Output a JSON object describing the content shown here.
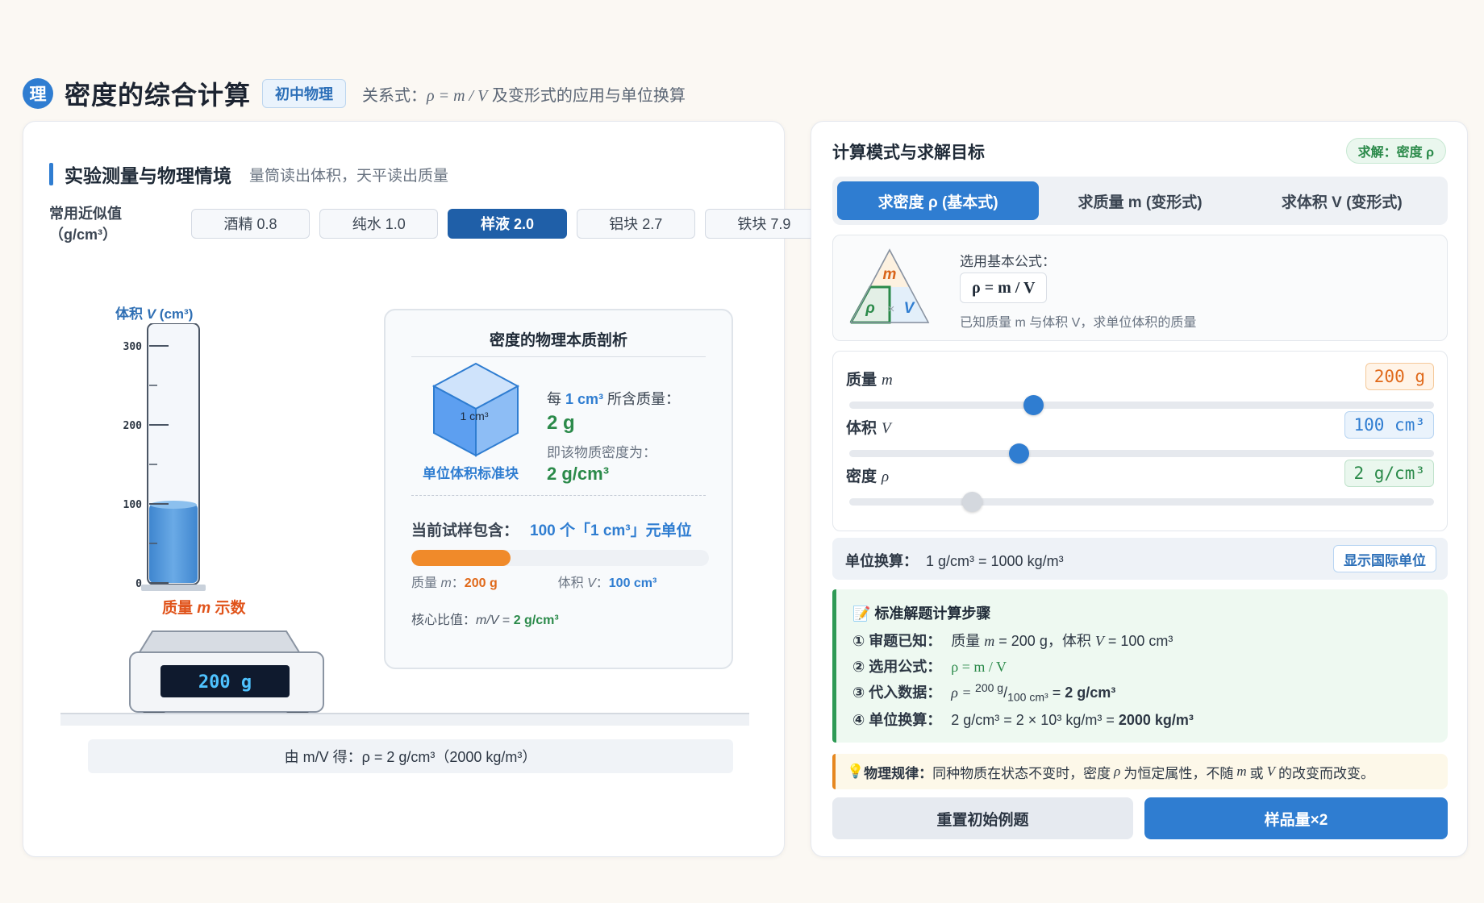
{
  "header": {
    "logo": "理",
    "title": "密度的综合计算",
    "tag": "初中物理",
    "subtitle_prefix": "关系式：",
    "subtitle_formula": "ρ = m / V",
    "subtitle_suffix": " 及变形式的应用与单位换算"
  },
  "left": {
    "section_title": "实验测量与物理情境",
    "section_subtitle": "量筒读出体积，天平读出质量",
    "approx_label": "常用近似值（g/cm³）",
    "chips": [
      "酒精 0.8",
      "纯水 1.0",
      "样液 2.0",
      "铝块 2.7",
      "铁块 7.9"
    ],
    "active_chip_index": 2,
    "cylinder": {
      "axis_label_prefix": "体积 ",
      "axis_label_var": "V",
      "axis_label_unit": " (cm³)",
      "ticks": [
        "300",
        "200",
        "100",
        "0"
      ],
      "tick_values": [
        300,
        200,
        100,
        0
      ],
      "max": 300,
      "liquid_volume": 100
    },
    "scale": {
      "label_prefix": "质量 ",
      "label_var": "m",
      "label_suffix": " 示数",
      "display": "200 g"
    },
    "result_strip": "由 m/V 得：ρ = 2 g/cm³（2000 kg/m³）",
    "analysis": {
      "title": "密度的物理本质剖析",
      "cube_label": "1 cm³",
      "cube_caption": "单位体积标准块",
      "per_prefix": "每 ",
      "per_unit": "1 cm³",
      "per_suffix": " 所含质量：",
      "per_value": "2 g",
      "density_label": "即该物质密度为：",
      "density_value": "2 g/cm³",
      "contain_label": "当前试样包含：",
      "contain_value": "100 个「1 cm³」元单位",
      "progress_fraction": 0.333,
      "mass_label": "质量 ",
      "mass_var": "m",
      "mass_colon": "：",
      "mass_value": "200 g",
      "vol_label": "体积 ",
      "vol_var": "V",
      "vol_colon": "：",
      "vol_value": "100 cm³",
      "ratio_label": "核心比值：",
      "ratio_expr": "m/V",
      "ratio_eq": " = ",
      "ratio_value": "2 g/cm³"
    }
  },
  "right": {
    "title": "计算模式与求解目标",
    "solve_badge": "求解：密度 ρ",
    "modes": [
      "求密度 ρ (基本式)",
      "求质量 m (变形式)",
      "求体积 V (变形式)"
    ],
    "active_mode": 0,
    "formula_card": {
      "label": "选用基本公式：",
      "formula": "ρ = m / V",
      "desc": "已知质量 m 与体积 V，求单位体积的质量",
      "tri_top": "m",
      "tri_left": "ρ",
      "tri_mid": "×",
      "tri_right": "V"
    },
    "sliders": [
      {
        "label": "质量",
        "var": "m",
        "value": "200 g",
        "fraction": 0.315
      },
      {
        "label": "体积",
        "var": "V",
        "value": "100 cm³",
        "fraction": 0.29
      },
      {
        "label": "密度",
        "var": "ρ",
        "value": "2 g/cm³",
        "fraction": 0.21
      }
    ],
    "unit": {
      "label": "单位换算：",
      "text": "1 g/cm³ = 1000 kg/m³",
      "button": "显示国际单位"
    },
    "steps": {
      "title": "📝 标准解题计算步骤",
      "s1_label": "① 审题已知：",
      "s1_a": "质量 ",
      "s1_m": "m",
      "s1_b": " = 200 g，体积 ",
      "s1_v": "V",
      "s1_c": " = 100 cm³",
      "s2_label": "② 选用公式：",
      "s2_formula": "ρ = m / V",
      "s3_label": "③ 代入数据：",
      "s3_rho": "ρ = ",
      "s3_num": "200 g",
      "s3_slash": "/",
      "s3_den": "100 cm³",
      "s3_eq": " = ",
      "s3_res": "2 g/cm³",
      "s4_label": "④ 单位换算：",
      "s4_text": "2 g/cm³ = 2 × 10³ kg/m³ = ",
      "s4_res": "2000 kg/m³"
    },
    "law": {
      "icon": "💡",
      "label": "物理规律：",
      "a": "同种物质在状态不变时，密度",
      "rho": "ρ",
      "b": "为恒定属性，不随",
      "m": "m",
      "c": "或",
      "v": "V",
      "d": "的改变而改变。"
    },
    "buttons": {
      "reset": "重置初始例题",
      "double": "样品量×2"
    }
  }
}
